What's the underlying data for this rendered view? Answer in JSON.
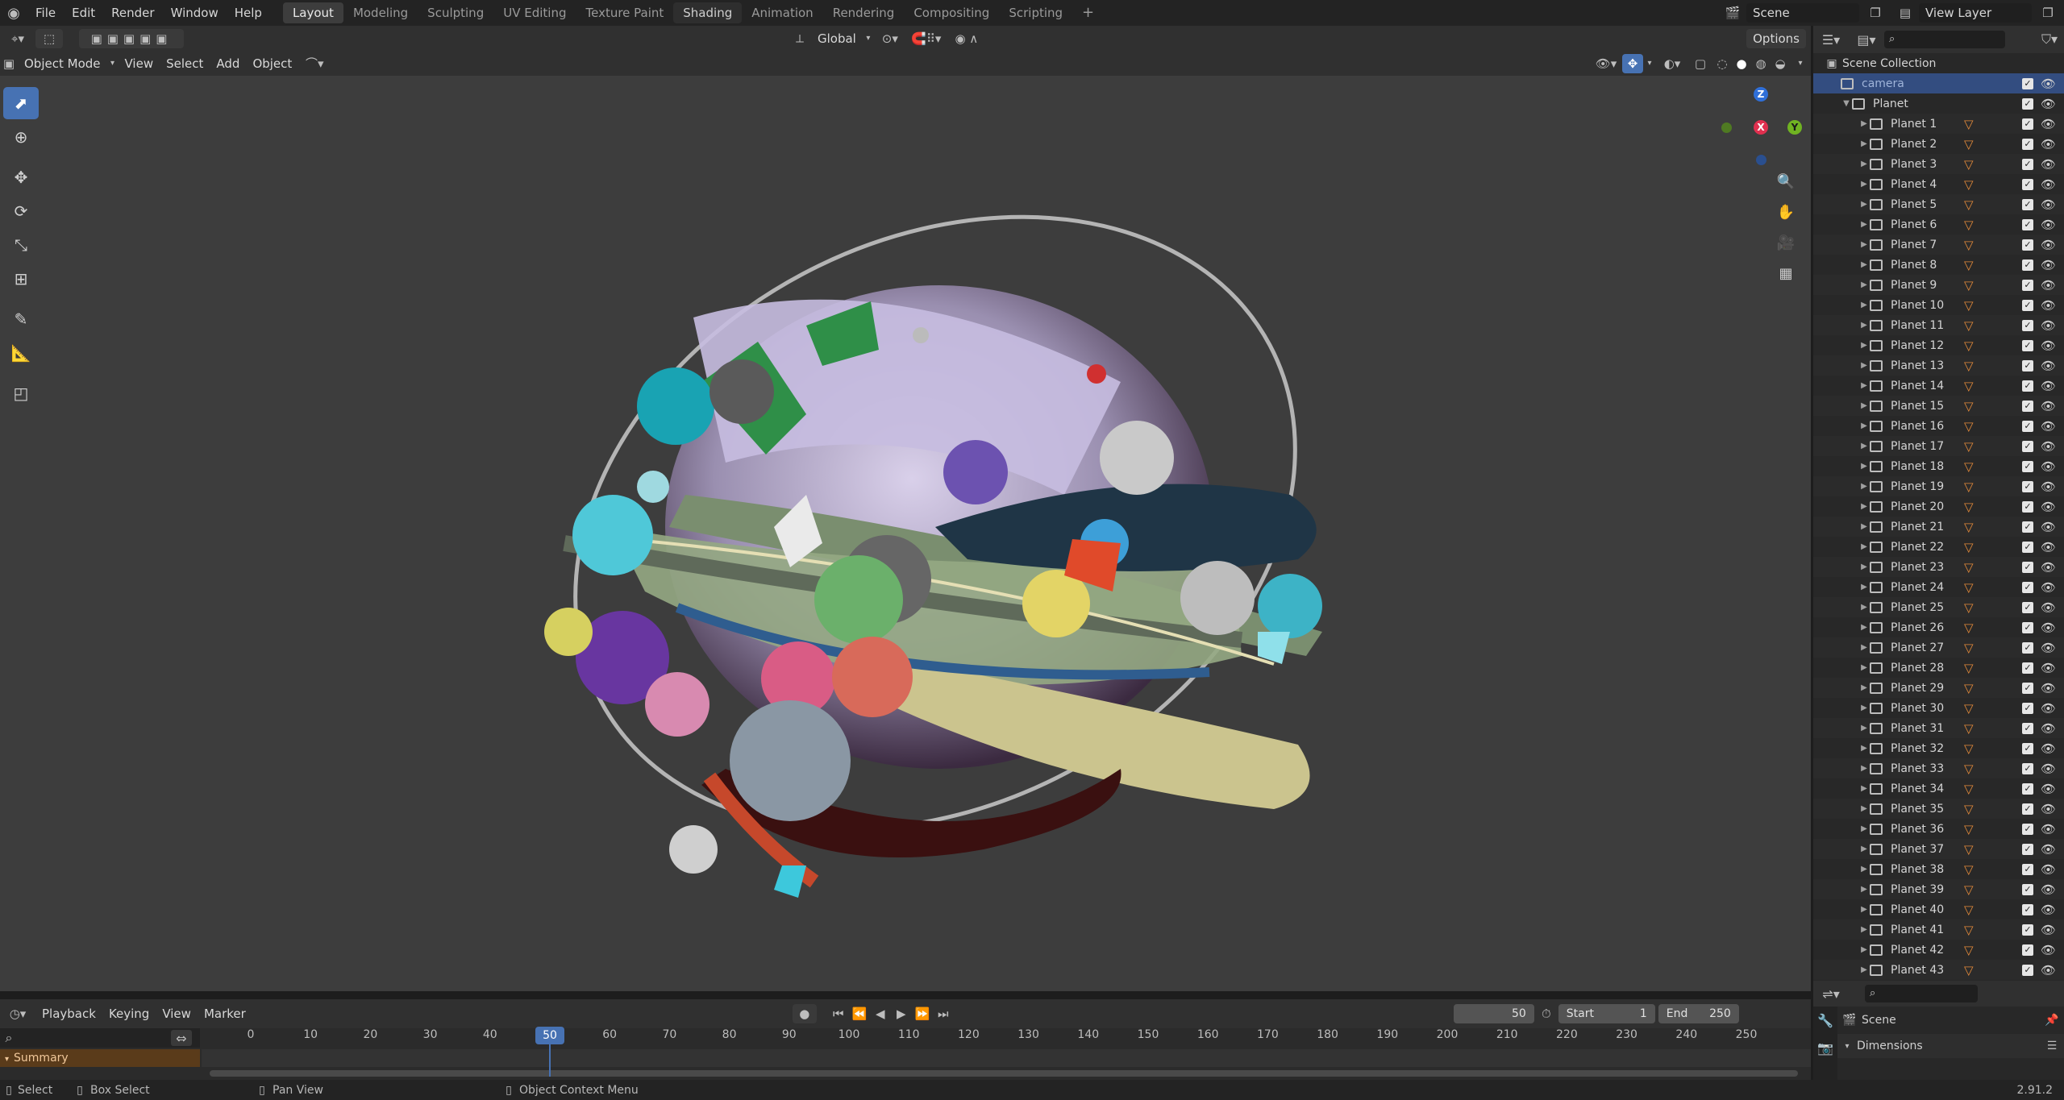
{
  "topbar": {
    "menus": [
      "File",
      "Edit",
      "Render",
      "Window",
      "Help"
    ],
    "workspaces": [
      "Layout",
      "Modeling",
      "Sculpting",
      "UV Editing",
      "Texture Paint",
      "Shading",
      "Animation",
      "Rendering",
      "Compositing",
      "Scripting"
    ],
    "active_workspace": "Layout",
    "add": "+",
    "scene": "Scene",
    "view_layer": "View Layer"
  },
  "header": {
    "transform": "Global",
    "options": "Options",
    "mode": "Object Mode",
    "menus": [
      "View",
      "Select",
      "Add",
      "Object"
    ]
  },
  "gizmo": {
    "x": "X",
    "y": "Y",
    "z": "Z"
  },
  "outliner": {
    "root": "Scene Collection",
    "items": [
      {
        "name": "camera",
        "selected": true
      },
      {
        "name": "Planet"
      },
      {
        "name": "Planet 1"
      },
      {
        "name": "Planet 2"
      },
      {
        "name": "Planet 3"
      },
      {
        "name": "Planet 4"
      },
      {
        "name": "Planet 5"
      },
      {
        "name": "Planet 6"
      },
      {
        "name": "Planet 7"
      },
      {
        "name": "Planet 8"
      },
      {
        "name": "Planet 9"
      },
      {
        "name": "Planet 10"
      },
      {
        "name": "Planet 11"
      },
      {
        "name": "Planet 12"
      },
      {
        "name": "Planet 13"
      },
      {
        "name": "Planet 14"
      },
      {
        "name": "Planet 15"
      },
      {
        "name": "Planet 16"
      },
      {
        "name": "Planet 17"
      },
      {
        "name": "Planet 18"
      },
      {
        "name": "Planet 19"
      },
      {
        "name": "Planet 20"
      },
      {
        "name": "Planet 21"
      },
      {
        "name": "Planet 22"
      },
      {
        "name": "Planet 23"
      },
      {
        "name": "Planet 24"
      },
      {
        "name": "Planet 25"
      },
      {
        "name": "Planet 26"
      },
      {
        "name": "Planet 27"
      },
      {
        "name": "Planet 28"
      },
      {
        "name": "Planet 29"
      },
      {
        "name": "Planet 30"
      },
      {
        "name": "Planet 31"
      },
      {
        "name": "Planet 32"
      },
      {
        "name": "Planet 33"
      },
      {
        "name": "Planet 34"
      },
      {
        "name": "Planet 35"
      },
      {
        "name": "Planet 36"
      },
      {
        "name": "Planet 37"
      },
      {
        "name": "Planet 38"
      },
      {
        "name": "Planet 39"
      },
      {
        "name": "Planet 40"
      },
      {
        "name": "Planet 41"
      },
      {
        "name": "Planet 42"
      },
      {
        "name": "Planet 43"
      }
    ]
  },
  "properties": {
    "scene": "Scene",
    "panel": "Dimensions"
  },
  "timeline": {
    "menus": [
      "Playback",
      "Keying",
      "View",
      "Marker"
    ],
    "current_frame": "50",
    "start_label": "Start",
    "start": "1",
    "end_label": "End",
    "end": "250",
    "summary": "Summary",
    "ticks": [
      "0",
      "10",
      "20",
      "30",
      "40",
      "50",
      "60",
      "70",
      "80",
      "90",
      "100",
      "110",
      "120",
      "130",
      "140",
      "150",
      "160",
      "170",
      "180",
      "190",
      "200",
      "210",
      "220",
      "230",
      "240",
      "250"
    ]
  },
  "status": {
    "select": "Select",
    "box_select": "Box Select",
    "pan": "Pan View",
    "context": "Object Context Menu",
    "version": "2.91.2"
  },
  "colors": {
    "accent": "#4772b3",
    "selected_row": "#334d80",
    "mesh_icon": "#e38a3a"
  }
}
